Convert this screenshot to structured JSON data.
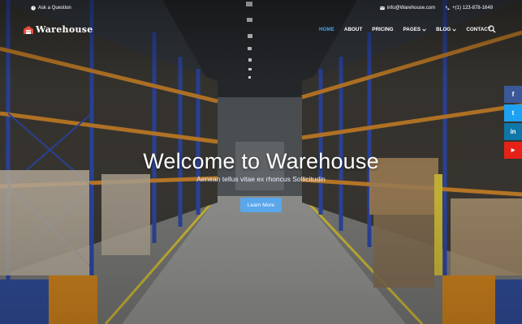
{
  "topbar": {
    "question": "Ask a Question",
    "email": "info@Warehouse.com",
    "phone": "+(1) 123-878-1649"
  },
  "brand": {
    "name": "Warehouse"
  },
  "menu": [
    {
      "label": "HOME",
      "active": true
    },
    {
      "label": "ABOUT"
    },
    {
      "label": "PRICING"
    },
    {
      "label": "PAGES",
      "dropdown": true
    },
    {
      "label": "BLOG",
      "dropdown": true
    },
    {
      "label": "CONTACT"
    }
  ],
  "hero": {
    "title": "Welcome to Warehouse",
    "subtitle": "Aenean tellus vitae ex rhoncus Sollicitudin",
    "cta": "Learn More"
  },
  "social": [
    {
      "icon": "facebook-icon",
      "glyph": "f",
      "color": "#3b5998"
    },
    {
      "icon": "twitter-icon",
      "glyph": "t",
      "color": "#1da1f2"
    },
    {
      "icon": "linkedin-icon",
      "glyph": "in",
      "color": "#0e76a8"
    },
    {
      "icon": "youtube-icon",
      "glyph": "▶",
      "color": "#e62117"
    }
  ],
  "colors": {
    "accent": "#4aa3e8",
    "button": "#5aa7ec"
  }
}
